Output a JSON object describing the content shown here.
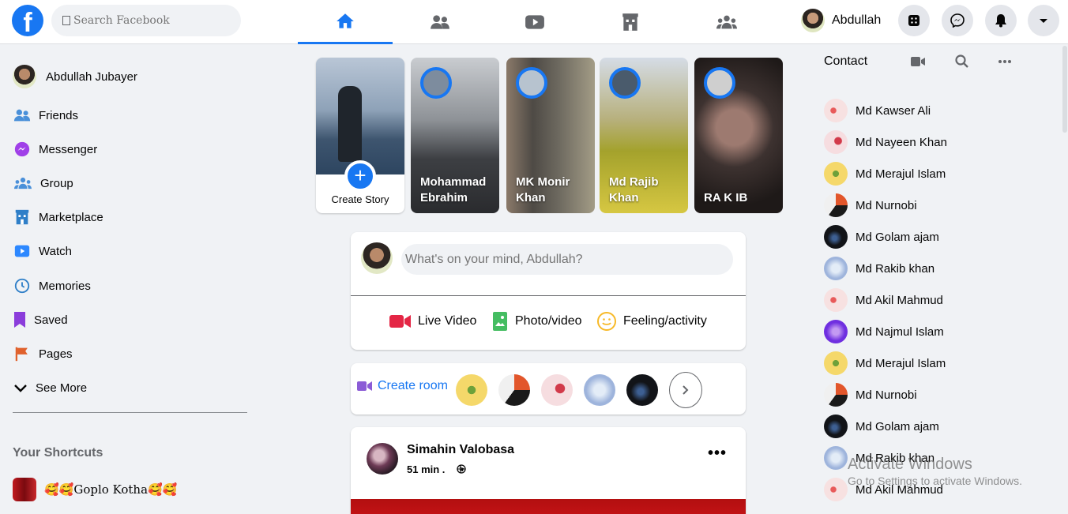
{
  "header": {
    "logo": "f",
    "search_placeholder": "Search Facebook",
    "tabs": [
      "home-icon",
      "friends-icon",
      "watch-icon",
      "marketplace-icon",
      "groups-icon"
    ],
    "profile_name": "Abdullah",
    "buttons": [
      "menu-icon",
      "messenger-icon",
      "bell-icon",
      "caret-down-icon"
    ],
    "brand_color": "#1877f2"
  },
  "sidebar": {
    "user": "Abdullah Jubayer",
    "items": [
      {
        "label": "Friends",
        "icon": "friends-icon"
      },
      {
        "label": "Messenger",
        "icon": "messenger-icon"
      },
      {
        "label": "Group",
        "icon": "group-icon"
      },
      {
        "label": "Marketplace",
        "icon": "marketplace-icon"
      },
      {
        "label": "Watch",
        "icon": "watch-icon"
      },
      {
        "label": "Memories",
        "icon": "clock-icon"
      },
      {
        "label": "Saved",
        "icon": "bookmark-icon"
      },
      {
        "label": "Pages",
        "icon": "flag-icon"
      },
      {
        "label": "See More",
        "icon": "chevron-down-icon"
      }
    ],
    "shortcuts_title": "Your Shortcuts",
    "shortcut": "🥰🥰Goplo Kotha🥰🥰"
  },
  "stories": {
    "create_label": "Create Story",
    "items": [
      {
        "name": "Mohammad Ebrahim"
      },
      {
        "name": "MK Monir Khan"
      },
      {
        "name": "Md Rajib Khan"
      },
      {
        "name": "RA K IB"
      }
    ]
  },
  "composer": {
    "placeholder": "What's on your mind, Abdullah?",
    "live": "Live Video",
    "photo": "Photo/video",
    "feeling": "Feeling/activity"
  },
  "rooms": {
    "create_label": "Create room"
  },
  "post": {
    "author": "Simahin Valobasa",
    "time": "51 min .",
    "more": "•••"
  },
  "contacts": {
    "title": "Contact",
    "items": [
      "Md Kawser Ali",
      "Md Nayeen Khan",
      "Md Merajul Islam",
      "Md Nurnobi",
      "Md Golam ajam",
      "Md Rakib khan",
      "Md Akil Mahmud",
      "Md Najmul Islam",
      "Md Merajul Islam",
      "Md Nurnobi",
      "Md Golam ajam",
      "Md Rakib khan",
      "Md Akil Mahmud"
    ]
  },
  "watermark": {
    "line1": "Activate Windows",
    "line2": "Go to Settings to activate Windows."
  }
}
